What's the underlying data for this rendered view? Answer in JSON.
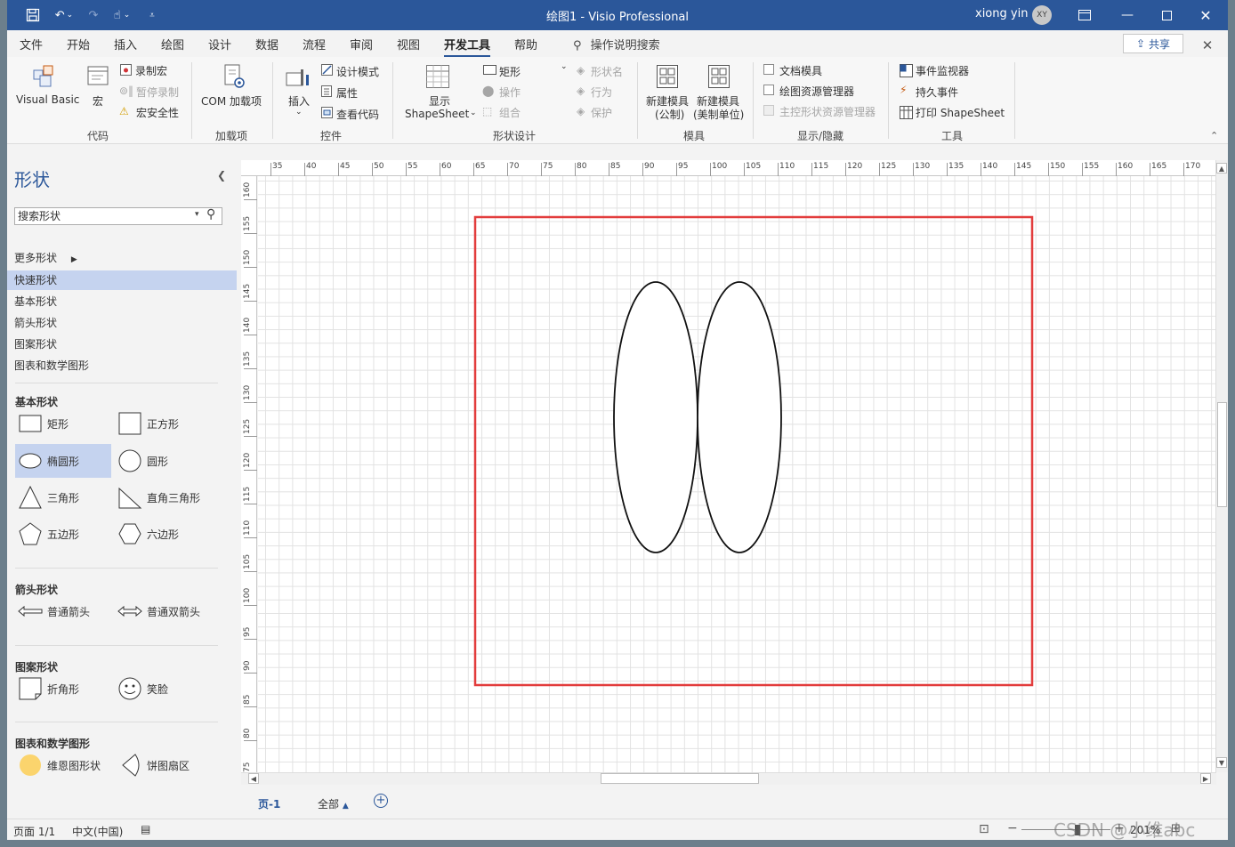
{
  "titlebar": {
    "title": "绘图1  -  Visio Professional",
    "user": "xiong yin",
    "avatar": "XY",
    "quick_access": [
      "save-icon",
      "undo-icon",
      "redo-icon",
      "touch-mode-icon",
      "customize-icon"
    ]
  },
  "tabs": [
    {
      "label": "文件"
    },
    {
      "label": "开始"
    },
    {
      "label": "插入"
    },
    {
      "label": "绘图"
    },
    {
      "label": "设计"
    },
    {
      "label": "数据"
    },
    {
      "label": "流程"
    },
    {
      "label": "审阅"
    },
    {
      "label": "视图"
    },
    {
      "label": "开发工具",
      "active": true
    },
    {
      "label": "帮助"
    }
  ],
  "tell_me": "操作说明搜索",
  "share": "共享",
  "ribbon": {
    "code": {
      "label": "代码",
      "visual_basic": "Visual Basic",
      "macros": "宏",
      "record_macro": "录制宏",
      "pause_recording": "暂停录制",
      "macro_security": "宏安全性"
    },
    "addins": {
      "label": "加载项",
      "com": "COM 加载项"
    },
    "controls": {
      "label": "控件",
      "insert": "插入",
      "design_mode": "设计模式",
      "properties": "属性",
      "view_code": "查看代码"
    },
    "shape_design": {
      "label": "形状设计",
      "show_shapesheet_1": "显示",
      "show_shapesheet_2": "ShapeSheet",
      "rectangle": "矩形",
      "operations": "操作",
      "group": "组合",
      "shape_name": "形状名",
      "behavior": "行为",
      "protection": "保护"
    },
    "stencil": {
      "label": "模具",
      "new_metric_1": "新建模具",
      "new_metric_2": "(公制)",
      "new_us_1": "新建模具",
      "new_us_2": "(美制单位)"
    },
    "show_hide": {
      "label": "显示/隐藏",
      "document_stencil": "文档模具",
      "drawing_explorer": "绘图资源管理器",
      "master_explorer": "主控形状资源管理器"
    },
    "tools": {
      "label": "工具",
      "event_monitor": "事件监视器",
      "persistent_events": "持久事件",
      "print_shapesheet": "打印 ShapeSheet"
    }
  },
  "panel": {
    "title": "形状",
    "search_placeholder": "搜索形状",
    "more_shapes": "更多形状",
    "nav": [
      "快速形状",
      "基本形状",
      "箭头形状",
      "图案形状",
      "图表和数学图形"
    ],
    "sections": {
      "basic": {
        "title": "基本形状",
        "items": [
          "矩形",
          "正方形",
          "椭圆形",
          "圆形",
          "三角形",
          "直角三角形",
          "五边形",
          "六边形"
        ]
      },
      "arrow": {
        "title": "箭头形状",
        "items": [
          "普通箭头",
          "普通双箭头"
        ]
      },
      "pattern": {
        "title": "图案形状",
        "items": [
          "折角形",
          "笑脸"
        ]
      },
      "chart": {
        "title": "图表和数学图形",
        "items": [
          "维恩图形状",
          "饼图扇区"
        ]
      }
    }
  },
  "rulers": {
    "h": [
      "35",
      "40",
      "45",
      "50",
      "55",
      "60",
      "65",
      "70",
      "75",
      "80",
      "85",
      "90",
      "95",
      "100",
      "105",
      "110",
      "115",
      "120",
      "125",
      "130",
      "135",
      "140",
      "145",
      "150",
      "155",
      "160",
      "165",
      "170"
    ],
    "v": [
      "160",
      "155",
      "150",
      "145",
      "140",
      "135",
      "130",
      "125",
      "120",
      "115",
      "110",
      "105",
      "100",
      "95",
      "90",
      "85",
      "80",
      "75"
    ]
  },
  "colors": {
    "accent": "#2b579a",
    "selection": "#e23c3c"
  },
  "pagetabs": {
    "page": "页-1",
    "all": "全部"
  },
  "status": {
    "page": "页面 1/1",
    "language": "中文(中国)",
    "zoom": "201%",
    "watermark": "CSDN @小维abc"
  }
}
